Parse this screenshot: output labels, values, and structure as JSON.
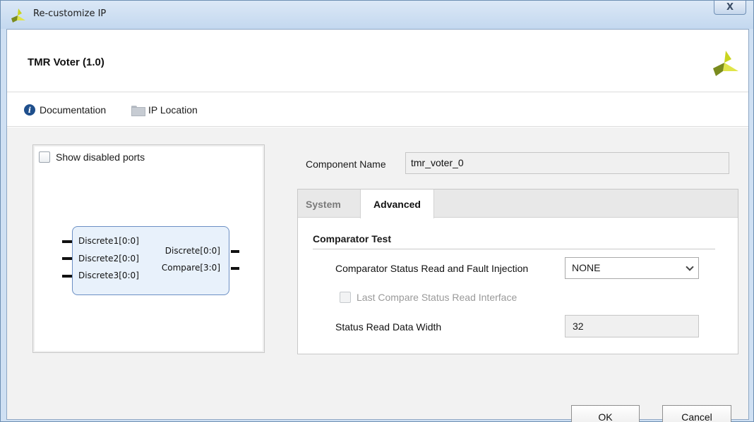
{
  "window": {
    "title": "Re-customize IP",
    "close_glyph": "X"
  },
  "header": {
    "ip_title": "TMR Voter (1.0)"
  },
  "toolbar": {
    "documentation": "Documentation",
    "ip_location": "IP Location"
  },
  "preview": {
    "show_disabled_ports": "Show disabled ports",
    "inputs": [
      "Discrete1[0:0]",
      "Discrete2[0:0]",
      "Discrete3[0:0]"
    ],
    "outputs": [
      "Discrete[0:0]",
      "Compare[3:0]"
    ]
  },
  "component": {
    "label": "Component Name",
    "value": "tmr_voter_0"
  },
  "tabs": {
    "system": "System",
    "advanced": "Advanced"
  },
  "advanced": {
    "section_title": "Comparator Test",
    "status_read_label": "Comparator Status Read and Fault Injection",
    "status_read_value": "NONE",
    "last_compare_label": "Last Compare Status Read Interface",
    "data_width_label": "Status Read Data Width",
    "data_width_value": "32"
  },
  "buttons": {
    "ok": "OK",
    "cancel": "Cancel"
  },
  "colors": {
    "brand_yellow": "#c9d41e",
    "brand_green": "#7a8b1e",
    "info_blue": "#1f4f8c"
  }
}
